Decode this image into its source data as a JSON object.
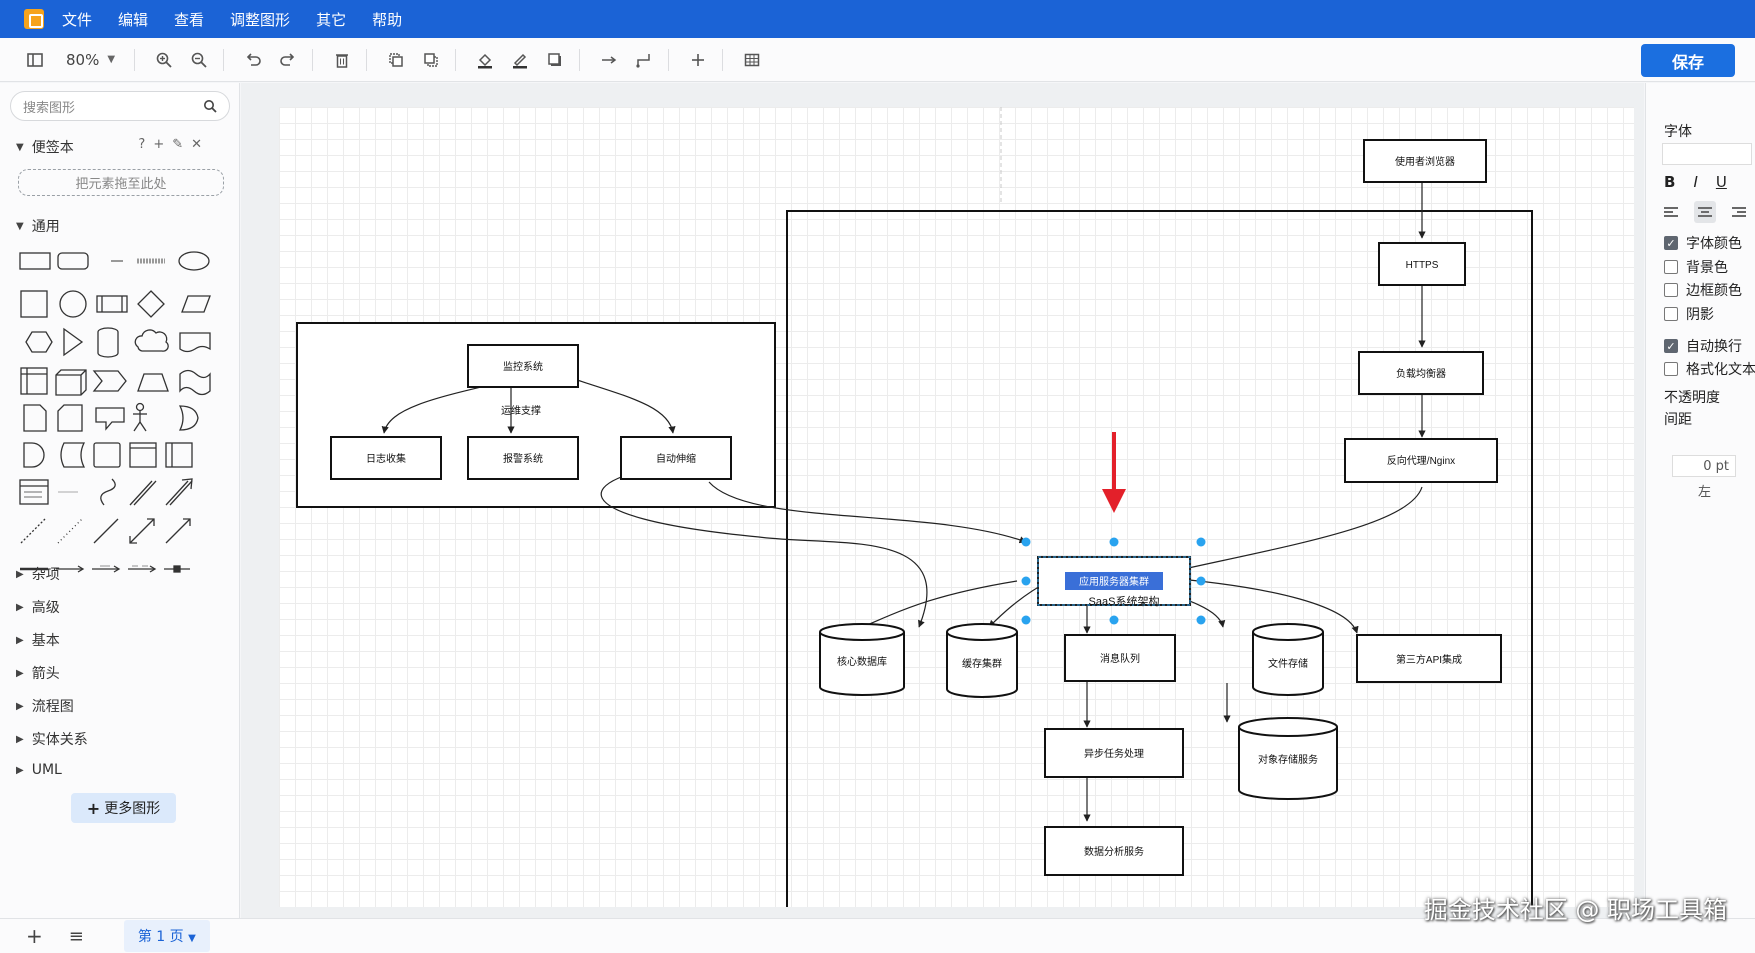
{
  "menubar": {
    "items": [
      "文件",
      "编辑",
      "查看",
      "调整图形",
      "其它",
      "帮助"
    ]
  },
  "toolbar": {
    "zoom": "80%",
    "save_label": "保存"
  },
  "sidebar": {
    "search_placeholder": "搜索图形",
    "scratchpad_title": "便签本",
    "drop_hint": "把元素拖至此处",
    "general_title": "通用",
    "collapsed_sections": [
      "杂项",
      "高级",
      "基本",
      "箭头",
      "流程图",
      "实体关系",
      "UML"
    ],
    "more_shapes_label": "更多图形"
  },
  "diagram": {
    "monitor": {
      "title": "监控系统",
      "sub_label": "运维支撑",
      "children": [
        "日志收集",
        "报警系统",
        "自动伸缩"
      ]
    },
    "flow": [
      "使用者浏览器",
      "HTTPS",
      "负载均衡器",
      "反向代理/Nginx"
    ],
    "selected_node": "应用服务器集群",
    "cluster_label": "SaaS系统架构",
    "services": [
      "核心数据库",
      "缓存集群",
      "消息队列",
      "文件存储",
      "第三方API集成"
    ],
    "downstream": [
      "异步任务处理",
      "对象存储服务",
      "数据分析服务"
    ]
  },
  "rpanel": {
    "font_label": "字体",
    "options": [
      {
        "label": "字体颜色",
        "checked": true
      },
      {
        "label": "背景色",
        "checked": false
      },
      {
        "label": "边框颜色",
        "checked": false
      },
      {
        "label": "阴影",
        "checked": false
      },
      {
        "label": "自动换行",
        "checked": true
      },
      {
        "label": "格式化文本",
        "checked": false
      }
    ],
    "opacity_label": "不透明度",
    "spacing_label": "间距",
    "spacing_value": "0 pt",
    "left_label": "左"
  },
  "bottombar": {
    "page_tab": "第 1 页"
  },
  "watermark": "掘金技术社区 @ 职场工具箱",
  "colors": {
    "accent": "#1b63d6",
    "selection": "#29a3ef",
    "arrow_red": "#e3202a"
  }
}
